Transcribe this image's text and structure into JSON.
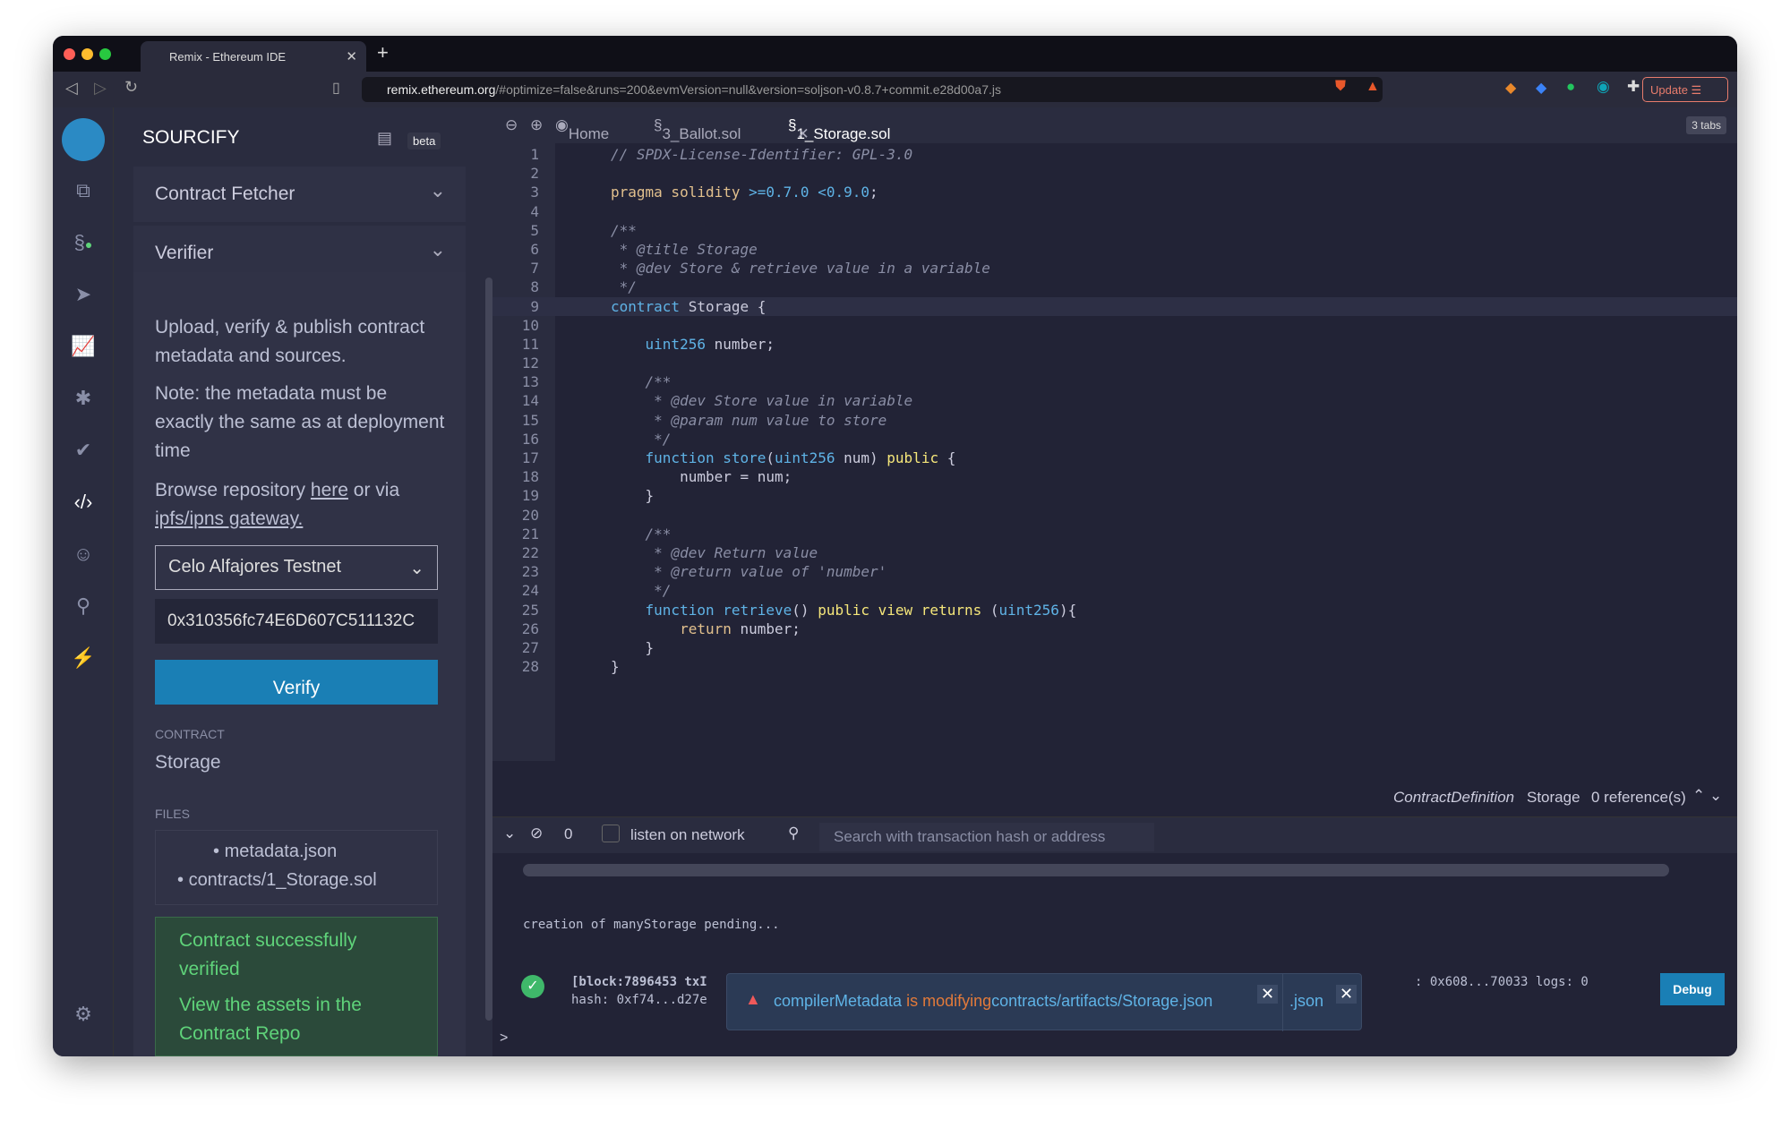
{
  "browser": {
    "tab_title": "Remix - Ethereum IDE",
    "url_host": "remix.ethereum.org",
    "url_rest": "/#optimize=false&runs=200&evmVersion=null&version=soljson-v0.8.7+commit.e28d00a7.js",
    "update_label": "Update",
    "brave_badge": "2",
    "alert_badge": "1"
  },
  "sidebar_icons": [
    "remix-logo-icon",
    "file-explorer-icon",
    "solidity-compiler-icon",
    "deploy-run-icon",
    "analysis-icon",
    "debugger-icon",
    "unit-test-icon",
    "sourcify-icon",
    "owl-icon",
    "search-plugin-icon",
    "plugin-manager-icon",
    "settings-icon"
  ],
  "panel": {
    "title": "SOURCIFY",
    "beta": "beta",
    "contract_fetcher": "Contract Fetcher",
    "verifier": "Verifier",
    "desc": "Upload, verify & publish contract metadata and sources.",
    "note": "Note: the metadata must be exactly the same as at deployment time",
    "browse_pre": "Browse repository ",
    "here": "here",
    "browse_mid": " or via ",
    "gateway": "ipfs/ipns gateway.",
    "network": "Celo Alfajores Testnet",
    "address": "0x310356fc74E6D607C511132C",
    "verify": "Verify",
    "contract_label": "CONTRACT",
    "contract_name": "Storage",
    "files_label": "FILES",
    "files": [
      "metadata.json",
      "contracts/1_Storage.sol"
    ],
    "success": "Contract successfully verified",
    "view_assets": "View the assets in the Contract Repo"
  },
  "editor": {
    "tabs": [
      "Home",
      "3_Ballot.sol",
      "1_Storage.sol"
    ],
    "tab_count": "3 tabs",
    "status": {
      "kind": "ContractDefinition",
      "name": "Storage",
      "refs": "0 reference(s)"
    }
  },
  "code": [
    [
      [
        "c",
        "// SPDX-License-Identifier: GPL-3.0"
      ]
    ],
    [],
    [
      [
        "k",
        "pragma solidity "
      ],
      [
        "t",
        ">=0.7.0 <0.9.0"
      ],
      [
        "n",
        ";"
      ]
    ],
    [],
    [
      [
        "c",
        "/**"
      ]
    ],
    [
      [
        "c",
        " * @title Storage"
      ]
    ],
    [
      [
        "c",
        " * @dev Store & retrieve value in a variable"
      ]
    ],
    [
      [
        "c",
        " */"
      ]
    ],
    [
      [
        "t",
        "contract "
      ],
      [
        "n",
        "Storage {"
      ]
    ],
    [],
    [
      [
        "t",
        "    uint256 "
      ],
      [
        "n",
        "number;"
      ]
    ],
    [],
    [
      [
        "c",
        "    /**"
      ]
    ],
    [
      [
        "c",
        "     * @dev Store value in variable"
      ]
    ],
    [
      [
        "c",
        "     * @param num value to store"
      ]
    ],
    [
      [
        "c",
        "     */"
      ]
    ],
    [
      [
        "t",
        "    function "
      ],
      [
        "f",
        "store"
      ],
      [
        "n",
        "("
      ],
      [
        "t",
        "uint256 "
      ],
      [
        "n",
        "num) "
      ],
      [
        "y",
        "public "
      ],
      [
        "n",
        "{"
      ]
    ],
    [
      [
        "n",
        "        number = num;"
      ]
    ],
    [
      [
        "n",
        "    }"
      ]
    ],
    [],
    [
      [
        "c",
        "    /**"
      ]
    ],
    [
      [
        "c",
        "     * @dev Return value"
      ]
    ],
    [
      [
        "c",
        "     * @return value of 'number'"
      ]
    ],
    [
      [
        "c",
        "     */"
      ]
    ],
    [
      [
        "t",
        "    function "
      ],
      [
        "f",
        "retrieve"
      ],
      [
        "n",
        "() "
      ],
      [
        "y",
        "public view returns "
      ],
      [
        "n",
        "("
      ],
      [
        "t",
        "uint256"
      ],
      [
        "n",
        "){"
      ]
    ],
    [
      [
        "k",
        "        return "
      ],
      [
        "n",
        "number;"
      ]
    ],
    [
      [
        "n",
        "    }"
      ]
    ],
    [
      [
        "n",
        "}"
      ]
    ]
  ],
  "terminal": {
    "count": "0",
    "listen": "listen on network",
    "search_placeholder": "Search with transaction hash or address",
    "pending": "creation of manyStorage pending...",
    "tx_line1": "[block:7896453 txI",
    "tx_line1_end": ": 0x608...70033 logs: 0",
    "tx_line2": "hash: 0xf74...d27e",
    "debug": "Debug",
    "toast_a": "compilerMetadata",
    "toast_b": " is modifying",
    "toast_c": "contracts/artifacts/Storage.json",
    "toast_d": ".json",
    "prompt": ">"
  },
  "colors": {
    "accent": "#1a7fb5",
    "success": "#5fd37a",
    "warning": "#e27a3a"
  }
}
